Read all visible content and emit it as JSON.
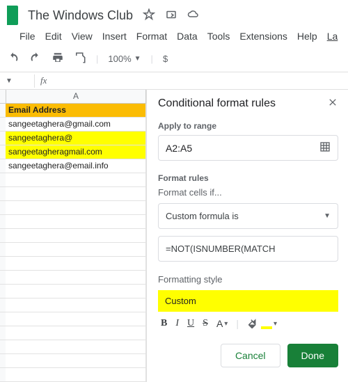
{
  "doc": {
    "title": "The Windows Club"
  },
  "menu": {
    "file": "File",
    "edit": "Edit",
    "view": "View",
    "insert": "Insert",
    "format": "Format",
    "data": "Data",
    "tools": "Tools",
    "extensions": "Extensions",
    "help": "Help",
    "last": "La"
  },
  "toolbar": {
    "zoom": "100%",
    "currency": "$"
  },
  "grid": {
    "col": "A",
    "rows": [
      {
        "text": "Email Address",
        "cls": "hdr"
      },
      {
        "text": "sangeetaghera@gmail.com",
        "cls": ""
      },
      {
        "text": "sangeetaghera@",
        "cls": "hl"
      },
      {
        "text": "sangeetagheragmail.com",
        "cls": "hl"
      },
      {
        "text": "sangeetaghera@email.info",
        "cls": ""
      }
    ]
  },
  "panel": {
    "title": "Conditional format rules",
    "apply_label": "Apply to range",
    "range": "A2:A5",
    "rules_label": "Format rules",
    "condition_label": "Format cells if...",
    "condition": "Custom formula is",
    "formula": "=NOT(ISNUMBER(MATCH",
    "style_label": "Formatting style",
    "style_name": "Custom",
    "bold": "B",
    "italic": "I",
    "underline": "U",
    "strike": "S",
    "textcolor": "A",
    "cancel": "Cancel",
    "done": "Done"
  }
}
